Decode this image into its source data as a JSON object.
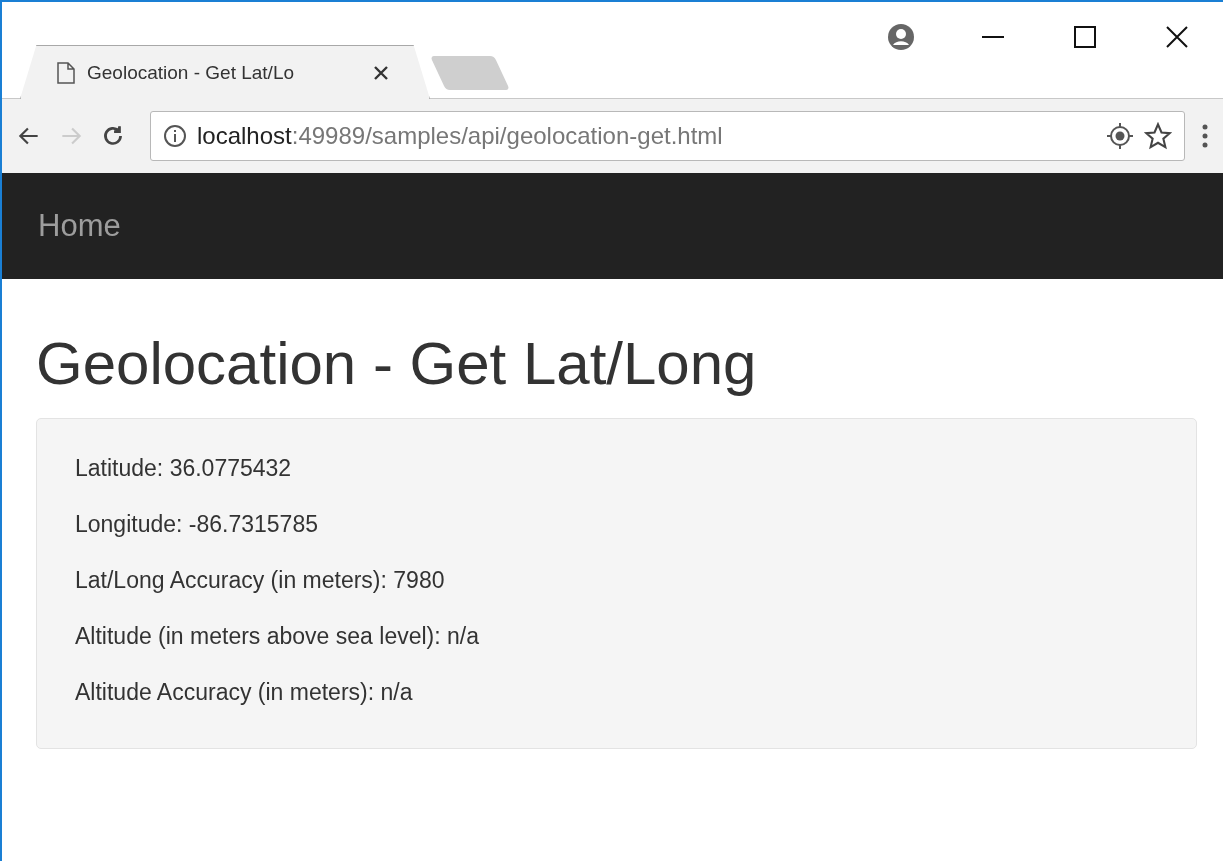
{
  "tab": {
    "title": "Geolocation - Get Lat/Lo"
  },
  "address": {
    "host": "localhost",
    "path": ":49989/samples/api/geolocation-get.html"
  },
  "navbar": {
    "brand": "Home"
  },
  "page": {
    "heading": "Geolocation - Get Lat/Long",
    "lines": [
      "Latitude: 36.0775432",
      "Longitude: -86.7315785",
      "Lat/Long Accuracy (in meters): 7980",
      "Altitude (in meters above sea level): n/a",
      "Altitude Accuracy (in meters): n/a"
    ]
  }
}
